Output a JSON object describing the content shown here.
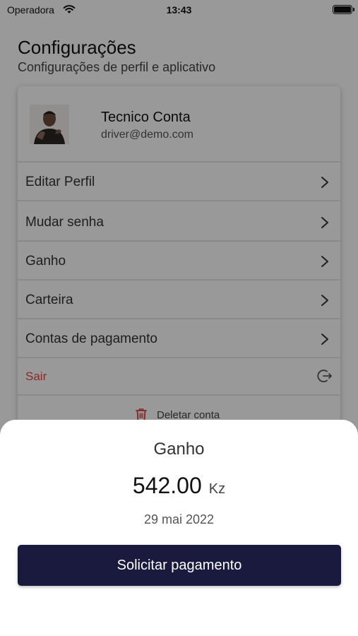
{
  "status_bar": {
    "carrier": "Operadora",
    "time": "13:43"
  },
  "header": {
    "title": "Configurações",
    "subtitle": "Configurações de perfil e aplicativo"
  },
  "profile": {
    "name": "Tecnico Conta",
    "email": "driver@demo.com"
  },
  "menu": {
    "items": [
      {
        "label": "Editar Perfil",
        "icon": "chevron-right-icon"
      },
      {
        "label": "Mudar senha",
        "icon": "chevron-right-icon"
      },
      {
        "label": "Ganho",
        "icon": "chevron-right-icon"
      },
      {
        "label": "Carteira",
        "icon": "chevron-right-icon"
      },
      {
        "label": "Contas de pagamento",
        "icon": "chevron-right-icon"
      }
    ],
    "logout_label": "Sair",
    "delete_label": "Deletar conta"
  },
  "sheet": {
    "title": "Ganho",
    "amount": "542.00",
    "currency": "Kz",
    "date": "29 mai 2022",
    "button_label": "Solicitar pagamento"
  },
  "colors": {
    "primary_button": "#191a3d",
    "logout": "#e04a4a",
    "delete_icon": "#d94040"
  }
}
